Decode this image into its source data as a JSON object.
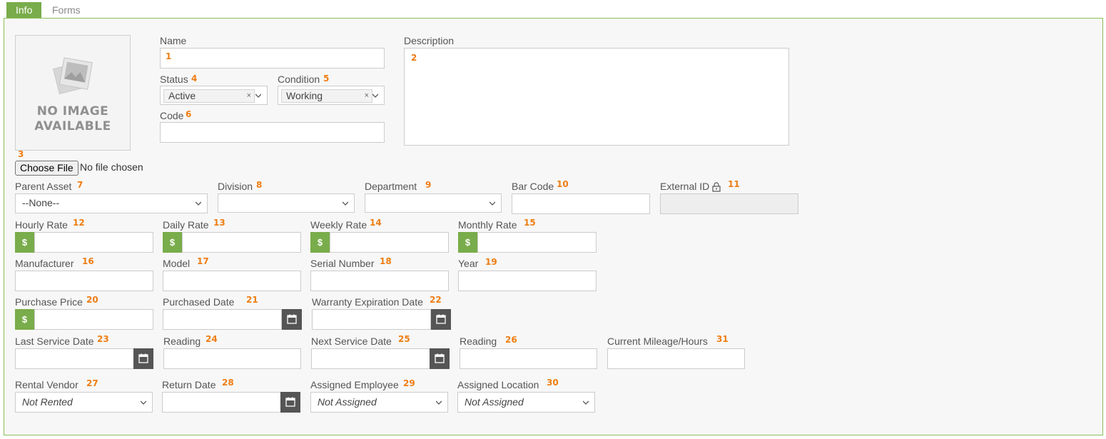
{
  "tabs": {
    "info": "Info",
    "forms": "Forms"
  },
  "image": {
    "line1": "NO IMAGE",
    "line2": "AVAILABLE"
  },
  "file": {
    "button": "Choose File",
    "status": "No file chosen",
    "num": "3"
  },
  "name": {
    "label": "Name",
    "num": "1"
  },
  "description": {
    "label": "Description",
    "num": "2"
  },
  "status": {
    "label": "Status",
    "num": "4",
    "value": "Active",
    "clear": "×"
  },
  "condition": {
    "label": "Condition",
    "num": "5",
    "value": "Working",
    "clear": "×"
  },
  "code": {
    "label": "Code",
    "num": "6"
  },
  "parent_asset": {
    "label": "Parent Asset",
    "num": "7",
    "value": "--None--"
  },
  "division": {
    "label": "Division",
    "num": "8"
  },
  "department": {
    "label": "Department",
    "num": "9"
  },
  "bar_code": {
    "label": "Bar Code",
    "num": "10"
  },
  "external_id": {
    "label": "External ID",
    "num": "11"
  },
  "hourly_rate": {
    "label": "Hourly Rate",
    "num": "12",
    "currency": "$"
  },
  "daily_rate": {
    "label": "Daily Rate",
    "num": "13",
    "currency": "$"
  },
  "weekly_rate": {
    "label": "Weekly Rate",
    "num": "14",
    "currency": "$"
  },
  "monthly_rate": {
    "label": "Monthly Rate",
    "num": "15",
    "currency": "$"
  },
  "manufacturer": {
    "label": "Manufacturer",
    "num": "16"
  },
  "model": {
    "label": "Model",
    "num": "17"
  },
  "serial_number": {
    "label": "Serial Number",
    "num": "18"
  },
  "year": {
    "label": "Year",
    "num": "19"
  },
  "purchase_price": {
    "label": "Purchase Price",
    "num": "20",
    "currency": "$"
  },
  "purchased_date": {
    "label": "Purchased Date",
    "num": "21"
  },
  "warranty_expiration": {
    "label": "Warranty Expiration Date",
    "num": "22"
  },
  "last_service_date": {
    "label": "Last Service Date",
    "num": "23"
  },
  "reading_1": {
    "label": "Reading",
    "num": "24"
  },
  "next_service_date": {
    "label": "Next Service Date",
    "num": "25"
  },
  "reading_2": {
    "label": "Reading",
    "num": "26"
  },
  "current_mileage": {
    "label": "Current Mileage/Hours",
    "num": "31"
  },
  "rental_vendor": {
    "label": "Rental Vendor",
    "num": "27",
    "value": "Not Rented"
  },
  "return_date": {
    "label": "Return Date",
    "num": "28"
  },
  "assigned_employee": {
    "label": "Assigned Employee",
    "num": "29",
    "value": "Not Assigned"
  },
  "assigned_location": {
    "label": "Assigned Location",
    "num": "30",
    "value": "Not Assigned"
  },
  "colors": {
    "accent": "#79ac4a",
    "panel_border": "#8cbd5a",
    "number": "#ef7d12",
    "calendar_button": "#555555"
  }
}
